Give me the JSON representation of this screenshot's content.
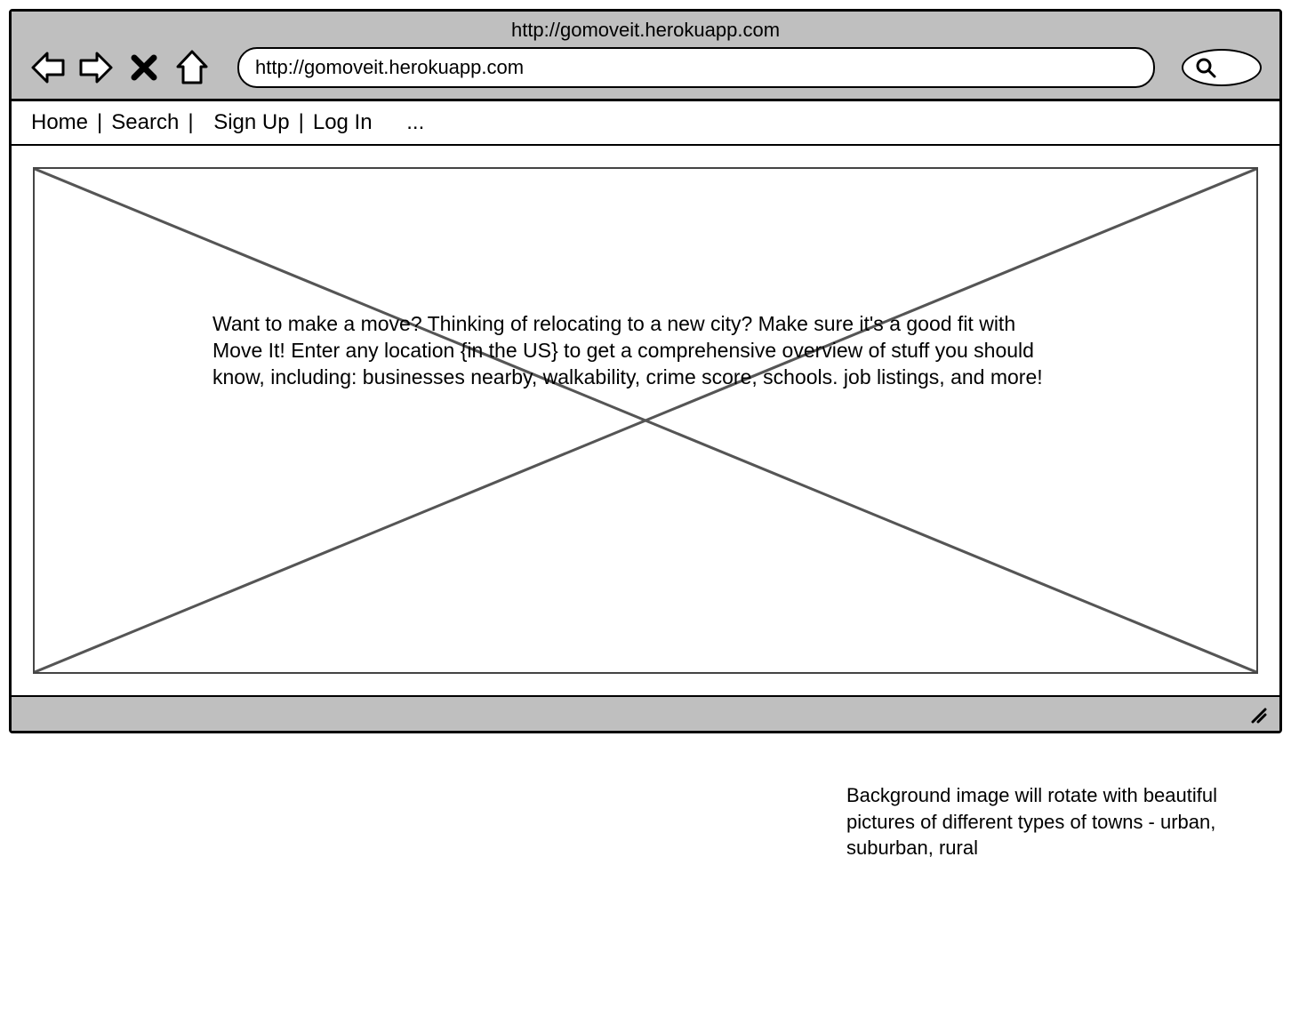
{
  "browser": {
    "title_url": "http://gomoveit.herokuapp.com",
    "address_bar": "http://gomoveit.herokuapp.com"
  },
  "menu": {
    "home": "Home",
    "search": "Search",
    "signup": "Sign Up",
    "login": "Log In",
    "more": "...",
    "sep": "|"
  },
  "hero": {
    "text": "Want to make a move? Thinking of relocating to a new city? Make sure it's a good fit with Move It! Enter any location {in the US} to get a comprehensive overview of stuff you should know, including: businesses nearby, walkability, crime score, schools. job listings, and more!"
  },
  "annotation": {
    "bg_note": "Background image will rotate with beautiful pictures of different types of towns - urban, suburban, rural"
  }
}
